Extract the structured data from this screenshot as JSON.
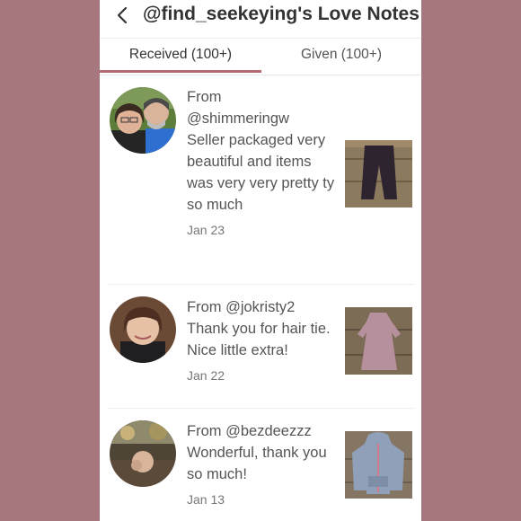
{
  "header": {
    "title": "@find_seekeying's Love Notes"
  },
  "tabs": [
    {
      "label": "Received (100+)",
      "active": true
    },
    {
      "label": "Given (100+)",
      "active": false
    }
  ],
  "notes": [
    {
      "from_prefix": "From",
      "user": "@shimmeringw",
      "message": "Seller packaged very beautiful and items was very very pretty ty so much",
      "date": "Jan 23"
    },
    {
      "from_prefix": "From",
      "user": "@jokristy2",
      "message": "Thank you for hair tie. Nice little extra!",
      "date": "Jan 22"
    },
    {
      "from_prefix": "From",
      "user": "@bezdeezzz",
      "message": "Wonderful, thank you so much!",
      "date": "Jan 13"
    }
  ],
  "colors": {
    "background": "#a6787e",
    "accent": "#b66b74",
    "text": "#555555"
  },
  "icons": {
    "back": "chevron-left-icon"
  }
}
